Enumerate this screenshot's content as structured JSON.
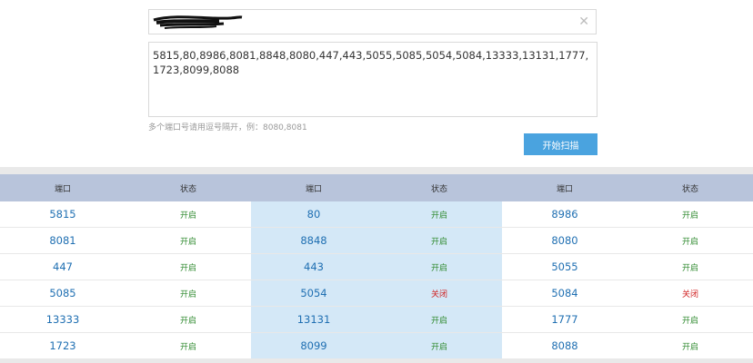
{
  "form": {
    "ports_value": "5815,80,8986,8081,8848,8080,447,443,5055,5085,5054,5084,13333,13131,1777,1723,8099,8088",
    "hint": "多个端口号请用逗号隔开，例：8080,8081",
    "scan_button": "开始扫描",
    "clear_icon": "close-icon"
  },
  "table": {
    "headers": [
      "端口",
      "状态",
      "端口",
      "状态",
      "端口",
      "状态"
    ],
    "rows": [
      [
        {
          "port": "5815",
          "status": "开启",
          "state": "open"
        },
        {
          "port": "80",
          "status": "开启",
          "state": "open"
        },
        {
          "port": "8986",
          "status": "开启",
          "state": "open"
        }
      ],
      [
        {
          "port": "8081",
          "status": "开启",
          "state": "open"
        },
        {
          "port": "8848",
          "status": "开启",
          "state": "open"
        },
        {
          "port": "8080",
          "status": "开启",
          "state": "open"
        }
      ],
      [
        {
          "port": "447",
          "status": "开启",
          "state": "open"
        },
        {
          "port": "443",
          "status": "开启",
          "state": "open"
        },
        {
          "port": "5055",
          "status": "开启",
          "state": "open"
        }
      ],
      [
        {
          "port": "5085",
          "status": "开启",
          "state": "open"
        },
        {
          "port": "5054",
          "status": "关闭",
          "state": "closed"
        },
        {
          "port": "5084",
          "status": "关闭",
          "state": "closed"
        }
      ],
      [
        {
          "port": "13333",
          "status": "开启",
          "state": "open"
        },
        {
          "port": "13131",
          "status": "开启",
          "state": "open"
        },
        {
          "port": "1777",
          "status": "开启",
          "state": "open"
        }
      ],
      [
        {
          "port": "1723",
          "status": "开启",
          "state": "open"
        },
        {
          "port": "8099",
          "status": "开启",
          "state": "open"
        },
        {
          "port": "8088",
          "status": "开启",
          "state": "open"
        }
      ]
    ]
  },
  "colors": {
    "header_bg": "#b8c4db",
    "middle_column_bg": "#d4e8f7",
    "port_text": "#1f6fb2",
    "status_open": "#2f8a2f",
    "status_closed": "#d02020",
    "button_bg": "#4aa3df"
  }
}
